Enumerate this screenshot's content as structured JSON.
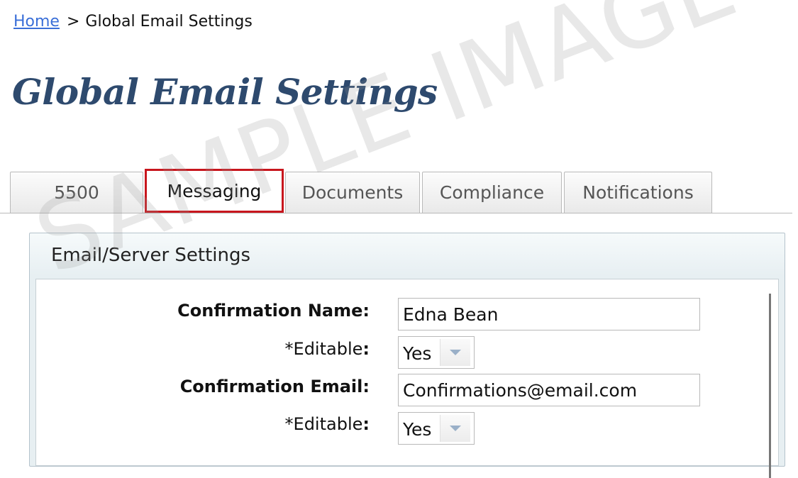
{
  "breadcrumb": {
    "home": "Home",
    "separator": ">",
    "current": "Global Email Settings"
  },
  "page_title": "Global Email Settings",
  "tabs": [
    {
      "label": "5500"
    },
    {
      "label": "Messaging",
      "active": true
    },
    {
      "label": "Documents"
    },
    {
      "label": "Compliance"
    },
    {
      "label": "Notifications"
    }
  ],
  "panel": {
    "title": "Email/Server Settings",
    "fields": [
      {
        "label": "Confirmation Name",
        "value": "Edna Bean"
      },
      {
        "label": "*Editable",
        "value": "Yes"
      },
      {
        "label": "Confirmation Email",
        "value": "Confirmations@email.com"
      },
      {
        "label": "*Editable",
        "value": "Yes"
      }
    ],
    "colon": ":"
  },
  "watermark": "SAMPLE IMAGE",
  "colors": {
    "title": "#2e4a6e",
    "link": "#3a6fd8",
    "active_tab_border": "#c8161d"
  },
  "icons": {
    "select_arrow": "chevron-down-icon"
  }
}
